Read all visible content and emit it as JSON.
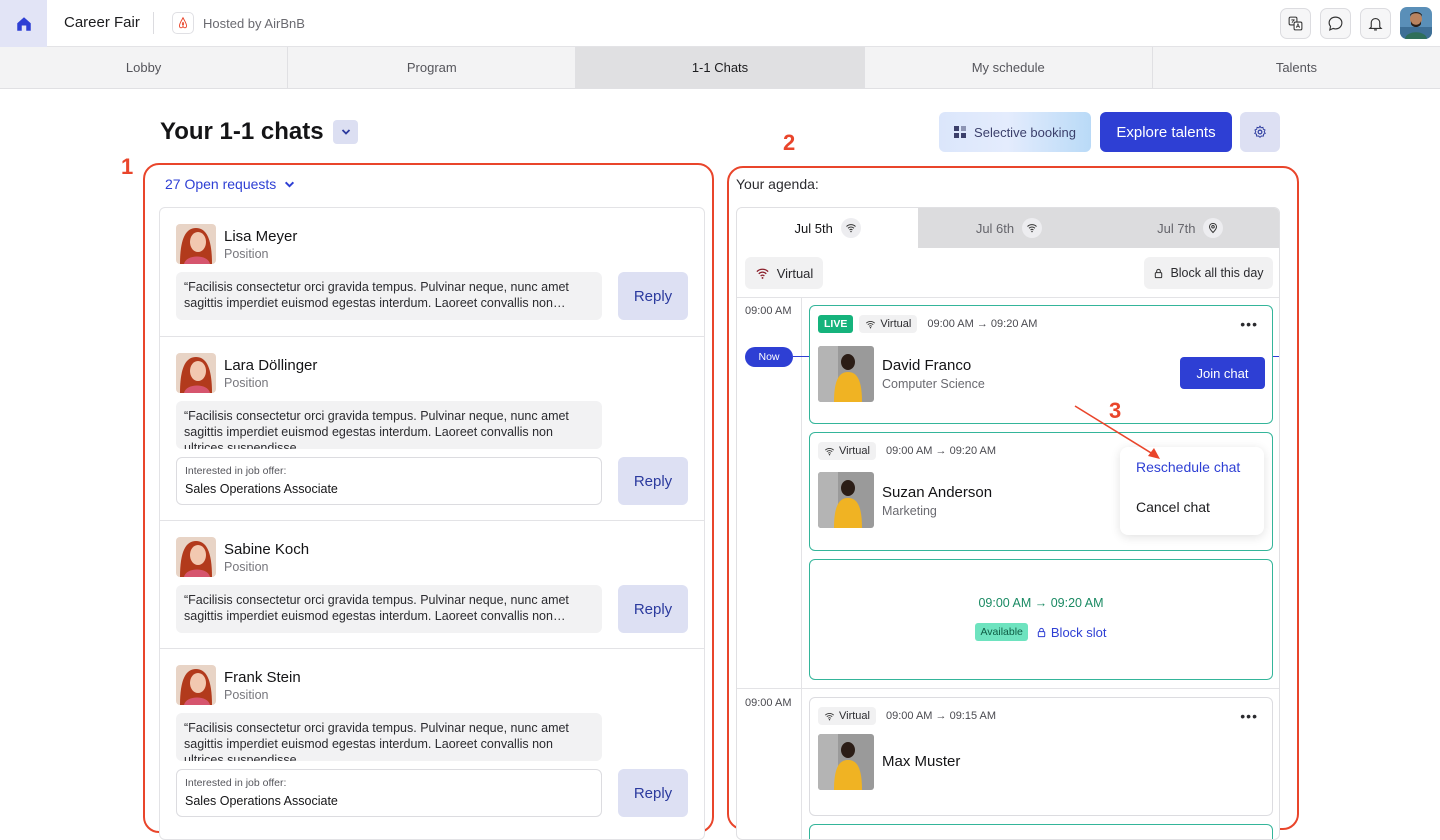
{
  "header": {
    "app_title": "Career Fair",
    "host_text": "Hosted by AirBnB",
    "icons": [
      "home-icon",
      "translate-icon",
      "chat-icon",
      "bell-icon"
    ]
  },
  "tabs": [
    {
      "label": "Lobby",
      "active": false
    },
    {
      "label": "Program",
      "active": false
    },
    {
      "label": "1-1 Chats",
      "active": true
    },
    {
      "label": "My schedule",
      "active": false
    },
    {
      "label": "Talents",
      "active": false
    }
  ],
  "page": {
    "title": "Your 1-1 chats",
    "selective_booking": "Selective booking",
    "explore_talents": "Explore talents"
  },
  "annotations": {
    "one": "1",
    "two": "2",
    "three": "3"
  },
  "requests": {
    "open_label": "27 Open requests",
    "items": [
      {
        "name": "Lisa Meyer",
        "position": "Position",
        "message": "“Facilisis consectetur orci gravida tempus. Pulvinar neque, nunc amet sagittis imperdiet euismod egestas interdum. Laoreet convallis non…",
        "reply": "Reply"
      },
      {
        "name": "Lara Döllinger",
        "position": "Position",
        "message": "“Facilisis consectetur orci gravida tempus. Pulvinar neque, nunc amet sagittis imperdiet euismod egestas interdum. Laoreet convallis non ultrices suspendisse…",
        "offer_label": "Interested in job offer:",
        "offer_value": "Sales Operations Associate",
        "reply": "Reply"
      },
      {
        "name": "Sabine Koch",
        "position": "Position",
        "message": "“Facilisis consectetur orci gravida tempus. Pulvinar neque, nunc amet sagittis imperdiet euismod egestas interdum. Laoreet convallis non…",
        "reply": "Reply"
      },
      {
        "name": "Frank Stein",
        "position": "Position",
        "message": "“Facilisis consectetur orci gravida tempus. Pulvinar neque, nunc amet sagittis imperdiet euismod egestas interdum. Laoreet convallis non ultrices suspendisse…",
        "offer_label": "Interested in job offer:",
        "offer_value": "Sales Operations Associate",
        "reply": "Reply"
      }
    ]
  },
  "agenda": {
    "label": "Your agenda:",
    "days": [
      {
        "label": "Jul 5th",
        "icon": "wifi-icon",
        "active": true
      },
      {
        "label": "Jul 6th",
        "icon": "wifi-icon",
        "active": false
      },
      {
        "label": "Jul 7th",
        "icon": "location-pin-icon",
        "active": false
      }
    ],
    "virtual_toggle": "Virtual",
    "block_day": "Block all this day",
    "time_1": "09:00 AM",
    "time_2": "09:00 AM",
    "now": "Now",
    "slots": [
      {
        "live": "LIVE",
        "mode": "Virtual",
        "time": "09:00 AM → 09:20 AM",
        "name": "David Franco",
        "sub": "Computer Science",
        "action": "Join chat"
      },
      {
        "mode": "Virtual",
        "time": "09:00 AM → 09:20 AM",
        "name": "Suzan Anderson",
        "sub": "Marketing"
      },
      {
        "time": "09:00 AM → 09:20 AM",
        "status": "Available",
        "action": "Block slot"
      },
      {
        "mode": "Virtual",
        "time": "09:00 AM → 09:15 AM",
        "name": "Max Muster"
      }
    ],
    "context_menu": {
      "reschedule": "Reschedule chat",
      "cancel": "Cancel chat"
    }
  },
  "colors": {
    "accent": "#2e3fd4",
    "live": "#15b37c",
    "slot_border": "#34b59a",
    "annotation": "#e9452b"
  }
}
